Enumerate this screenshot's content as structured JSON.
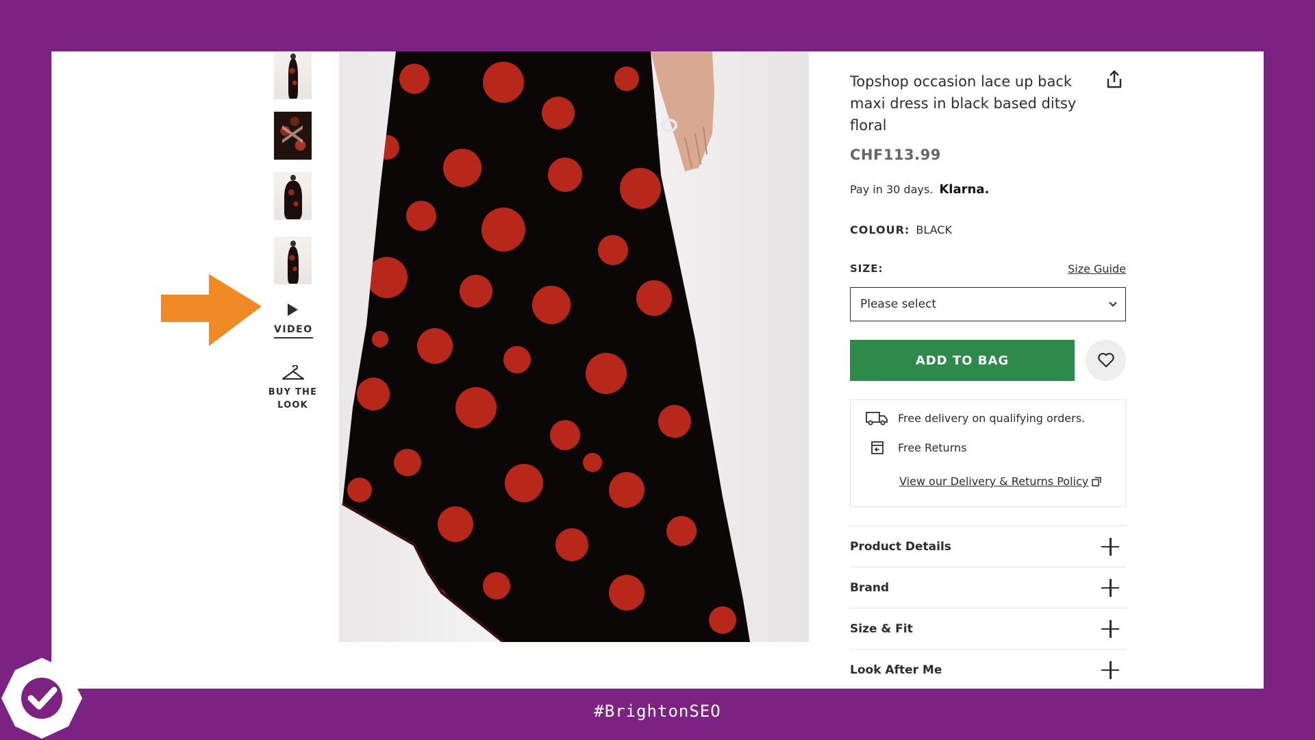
{
  "product": {
    "title": "Topshop occasion lace up back maxi dress in black based ditsy floral",
    "price": "CHF113.99",
    "klarna_text": "Pay in 30 days.",
    "klarna_logo": "Klarna.",
    "colour_label": "COLOUR:",
    "colour_value": "BLACK",
    "size_label": "SIZE:",
    "size_guide": "Size Guide",
    "size_placeholder": "Please select",
    "add_to_bag": "ADD TO BAG"
  },
  "gallery": {
    "video_label": "VIDEO",
    "buy_the_look_label": "BUY THE LOOK"
  },
  "delivery": {
    "free_delivery": "Free delivery on qualifying orders.",
    "free_returns": "Free Returns",
    "policy_link": "View our Delivery & Returns Policy"
  },
  "accordions": [
    {
      "label": "Product Details"
    },
    {
      "label": "Brand"
    },
    {
      "label": "Size & Fit"
    },
    {
      "label": "Look After Me"
    }
  ],
  "footer": {
    "hashtag": "#BrightonSEO"
  },
  "colors": {
    "slide_background": "#7b2282",
    "add_to_bag_green": "#2d8a4b",
    "annotation_arrow": "#f08a24",
    "dress_black": "#0b0707",
    "dress_red": "#b8281a"
  }
}
